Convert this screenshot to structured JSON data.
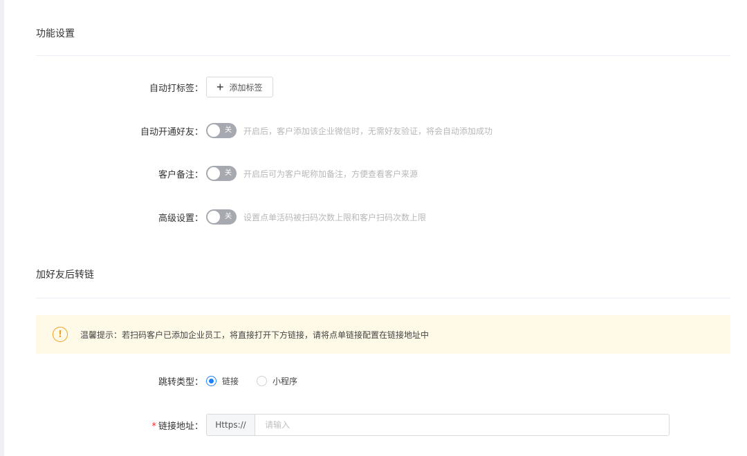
{
  "function_settings": {
    "title": "功能设置",
    "auto_tag": {
      "label": "自动打标签：",
      "button_label": "添加标签",
      "button_icon": "plus-icon"
    },
    "auto_friend": {
      "label": "自动开通好友：",
      "switch_text": "关",
      "hint": "开启后，客户添加该企业微信时，无需好友验证，将会自动添加成功"
    },
    "customer_remark": {
      "label": "客户备注：",
      "switch_text": "关",
      "hint": "开启后可为客户昵称加备注，方便查看客户来源"
    },
    "advanced": {
      "label": "高级设置：",
      "switch_text": "关",
      "hint": "设置点单活码被扫码次数上限和客户扫码次数上限"
    }
  },
  "redirect_section": {
    "title": "加好友后转链",
    "alert": {
      "icon": "exclamation-circle-icon",
      "text": "温馨提示：若扫码客户已添加企业员工，将直接打开下方链接，请将点单链接配置在链接地址中"
    },
    "redirect_type": {
      "label": "跳转类型：",
      "options": [
        {
          "label": "链接",
          "checked": true
        },
        {
          "label": "小程序",
          "checked": false
        }
      ]
    },
    "link_address": {
      "required_mark": "*",
      "label": "链接地址：",
      "prefix": "Https://",
      "value": "",
      "placeholder": "请输入"
    }
  },
  "colors": {
    "primary": "#1e7ffa",
    "switch_off": "#a6a9b0",
    "alert_bg": "#fff9e8",
    "alert_icon": "#f0a020",
    "required": "#f5222d"
  }
}
